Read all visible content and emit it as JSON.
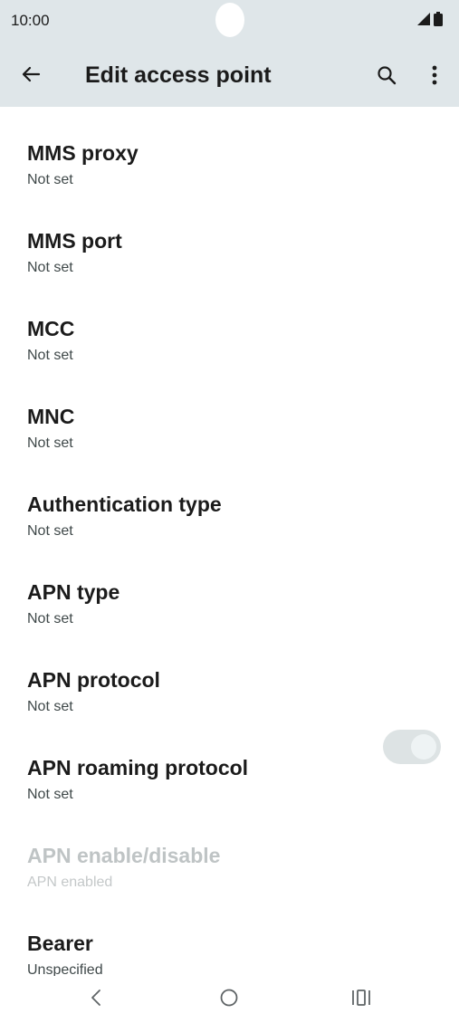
{
  "status_bar": {
    "time": "10:00",
    "icons": [
      "signal-icon",
      "battery-icon"
    ]
  },
  "app_bar": {
    "title": "Edit access point",
    "icons": [
      "back-arrow-icon",
      "search-icon",
      "more-vert-icon"
    ]
  },
  "preferences": [
    {
      "title": "MMS proxy",
      "summary": "Not set"
    },
    {
      "title": "MMS port",
      "summary": "Not set"
    },
    {
      "title": "MCC",
      "summary": "Not set"
    },
    {
      "title": "MNC",
      "summary": "Not set"
    },
    {
      "title": "Authentication type",
      "summary": "Not set"
    },
    {
      "title": "APN type",
      "summary": "Not set"
    },
    {
      "title": "APN protocol",
      "summary": "Not set"
    },
    {
      "title": "APN roaming protocol",
      "summary": "Not set"
    },
    {
      "title": "APN enable/disable",
      "summary": "APN enabled",
      "toggle_on": true,
      "enabled": false
    },
    {
      "title": "Bearer",
      "summary": "Unspecified"
    }
  ],
  "nav_bar": {
    "icons": [
      "back-nav-icon",
      "home-icon",
      "recents-icon"
    ]
  },
  "colors": {
    "app_bar_bg": "#dfe6e9",
    "text_primary": "#1b1b1b",
    "text_disabled": "#bfc4c5"
  }
}
